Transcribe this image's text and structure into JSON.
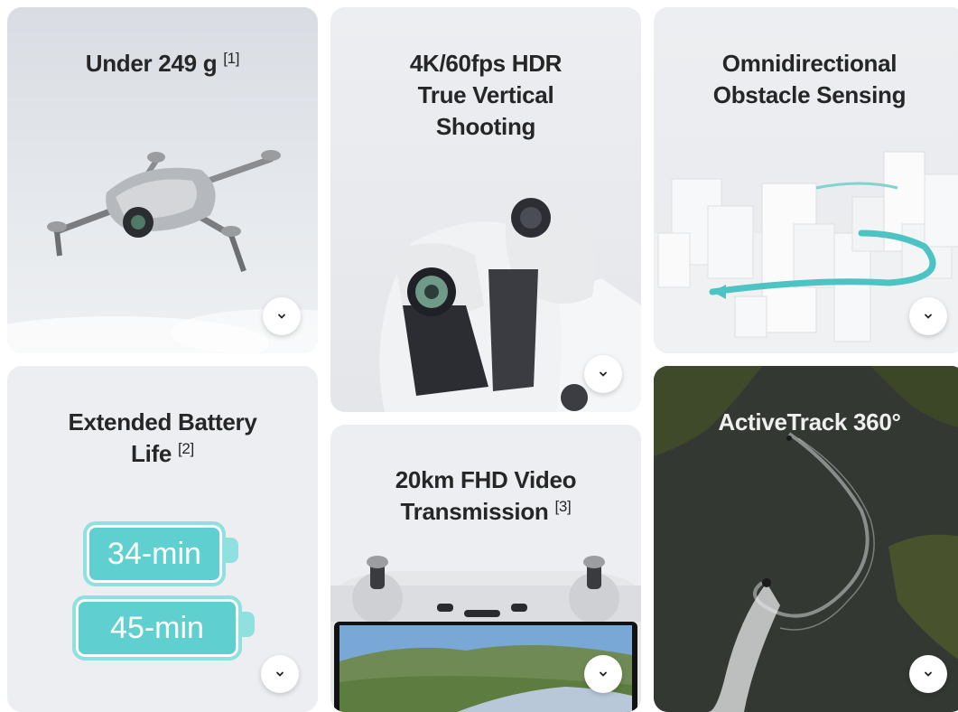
{
  "cards": {
    "weight": {
      "title": "Under 249 g",
      "note": "[1]"
    },
    "hdr": {
      "title_line1": "4K/60fps HDR",
      "title_line2": "True Vertical",
      "title_line3": "Shooting"
    },
    "obstacle": {
      "title_line1": "Omnidirectional",
      "title_line2": "Obstacle Sensing"
    },
    "battery": {
      "title_line1": "Extended Battery",
      "title_line2": "Life",
      "note": "[2]",
      "pill_standard": "34-min",
      "pill_plus": "45-min"
    },
    "transmission": {
      "title_line1": "20km FHD Video",
      "title_line2": "Transmission",
      "note": "[3]"
    },
    "activetrack": {
      "title": "ActiveTrack 360°"
    }
  },
  "icons": {
    "expand": "chevron-down-icon"
  },
  "colors": {
    "battery_fill": "#5fcfcf",
    "battery_rim": "#8fe0de",
    "track_line": "#4ec3c3"
  }
}
